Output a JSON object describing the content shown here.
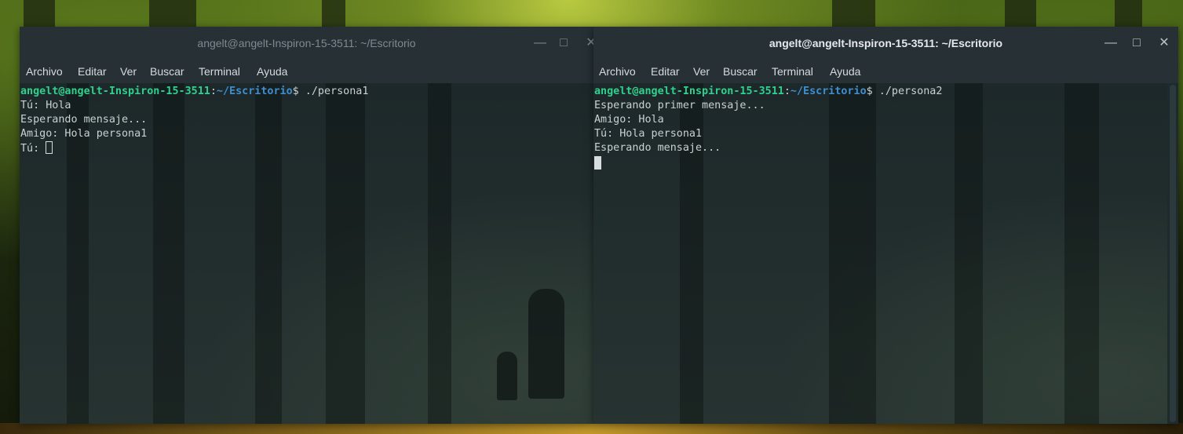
{
  "left_terminal": {
    "title": "angelt@angelt-Inspiron-15-3511: ~/Escritorio",
    "controls": {
      "minimize": "—",
      "maximize": "□",
      "close": "✕"
    },
    "menu": [
      "Archivo",
      "Editar",
      "Ver",
      "Buscar",
      "Terminal",
      "Ayuda"
    ],
    "prompt_user": "angelt@angelt-Inspiron-15-3511",
    "prompt_sep": ":",
    "prompt_path": "~/Escritorio",
    "prompt_end": "$ ",
    "command": "./persona1",
    "lines": [
      "Tú: Hola",
      "Esperando mensaje...",
      "Amigo: Hola persona1",
      "Tú: "
    ]
  },
  "right_terminal": {
    "title": "angelt@angelt-Inspiron-15-3511: ~/Escritorio",
    "controls": {
      "minimize": "—",
      "maximize": "□",
      "close": "✕"
    },
    "menu": [
      "Archivo",
      "Editar",
      "Ver",
      "Buscar",
      "Terminal",
      "Ayuda"
    ],
    "prompt_user": "angelt@angelt-Inspiron-15-3511",
    "prompt_sep": ":",
    "prompt_path": "~/Escritorio",
    "prompt_end": "$ ",
    "command": "./persona2",
    "lines": [
      "Esperando primer mensaje...",
      "Amigo: Hola",
      "Tú: Hola persona1",
      "Esperando mensaje..."
    ]
  },
  "colors": {
    "terminal_bg": "#263035",
    "prompt_user": "#2fd18d",
    "prompt_path": "#3e8ed0",
    "text": "#c9d1d3"
  }
}
